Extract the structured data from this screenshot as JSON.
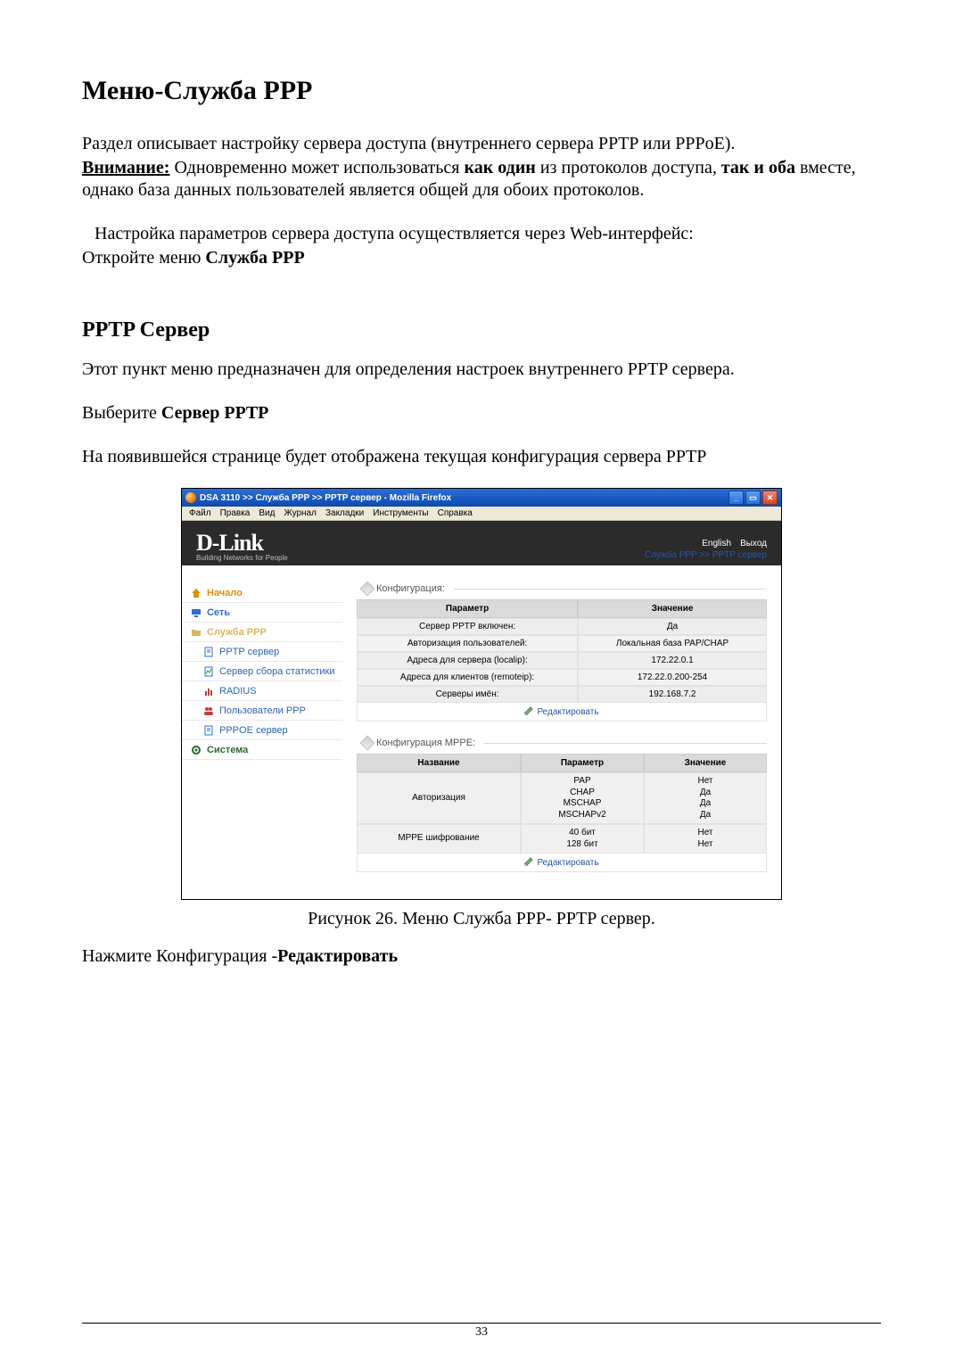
{
  "doc": {
    "h1": "Меню-Служба PPP",
    "p1": "Раздел описывает настройку сервера доступа (внутреннего сервера PPTP или PPPoE).",
    "p2_lead_u": "Внимание:",
    "p2_a": " Одновременно может использоваться ",
    "p2_b1": "как один",
    "p2_c": " из протоколов доступа, ",
    "p2_b2": "так и оба",
    "p2_d": " вместе, однако база данных пользователей является общей для обоих протоколов.",
    "p3": "Настройка параметров сервера доступа осуществляется через Web-интерфейс:",
    "p4_a": "Откройте меню ",
    "p4_b": "Служба PPP",
    "h2": "PPTP Сервер",
    "p5": "Этот пункт меню предназначен для определения настроек внутреннего PPTP сервера.",
    "p6_a": "Выберите ",
    "p6_b": "Сервер PPTP",
    "p7": "На появившейся странице будет отображена текущая конфигурация сервера PPTP",
    "caption": "Рисунок 26. Меню Служба PPP- PPTP сервер.",
    "p8_a": "Нажмите Конфигурация -",
    "p8_b": "Редактировать",
    "pagenum": "33"
  },
  "shot": {
    "title": "DSA 3110 >> Служба PPP >> PPTP сервер - Mozilla Firefox",
    "menu": [
      "Файл",
      "Правка",
      "Вид",
      "Журнал",
      "Закладки",
      "Инструменты",
      "Справка"
    ],
    "brand_logo": "D-Link",
    "brand_tag": "Building Networks for People",
    "lang_link": "English",
    "logout_link": "Выход",
    "breadcrumb": "Служба PPP >> PPTP сервер",
    "sidebar": [
      {
        "label": "Начало",
        "level": 1,
        "icon": "home-icon",
        "color": "#e08f00"
      },
      {
        "label": "Сеть",
        "level": 1,
        "icon": "monitor-icon",
        "color": "#2a6fd6"
      },
      {
        "label": "Служба PPP",
        "level": 1,
        "icon": "folder-icon",
        "color": "#d8b760"
      },
      {
        "label": "PPTP сервер",
        "level": 2,
        "icon": "page-icon",
        "color": "#2a6fd6"
      },
      {
        "label": "Сервер сбора статистики",
        "level": 2,
        "icon": "page-stats-icon",
        "color": "#2a6fd6"
      },
      {
        "label": "RADIUS",
        "level": 2,
        "icon": "barchart-icon",
        "color": "#c23b3b"
      },
      {
        "label": "Пользователи PPP",
        "level": 2,
        "icon": "users-icon",
        "color": "#c23b3b"
      },
      {
        "label": "PPPOE сервер",
        "level": 2,
        "icon": "page-icon",
        "color": "#2a6fd6"
      },
      {
        "label": "Система",
        "level": 1,
        "icon": "gear-icon",
        "color": "#2f6a2f"
      }
    ],
    "section1_label": "Конфигурация:",
    "table1_head": [
      "Параметр",
      "Значение"
    ],
    "table1_rows": [
      [
        "Сервер PPTP включен:",
        "Да"
      ],
      [
        "Авторизация пользователей:",
        "Локальная база PAP/CHAP"
      ],
      [
        "Адреса для сервера (localip):",
        "172.22.0.1"
      ],
      [
        "Адреса для клиентов (remoteip):",
        "172.22.0.200-254"
      ],
      [
        "Серверы имён:",
        "192.168.7.2"
      ]
    ],
    "edit_label": "Редактировать",
    "section2_label": "Конфигурация MPPE:",
    "table2_head": [
      "Название",
      "Параметр",
      "Значение"
    ],
    "table2_rows": [
      {
        "name": "Авторизация",
        "params": [
          "PAP",
          "CHAP",
          "MSCHAP",
          "MSCHAPv2"
        ],
        "values": [
          "Нет",
          "Да",
          "Да",
          "Да"
        ]
      },
      {
        "name": "MPPE шифрование",
        "params": [
          "40 бит",
          "128 бит"
        ],
        "values": [
          "Нет",
          "Нет"
        ]
      }
    ]
  }
}
